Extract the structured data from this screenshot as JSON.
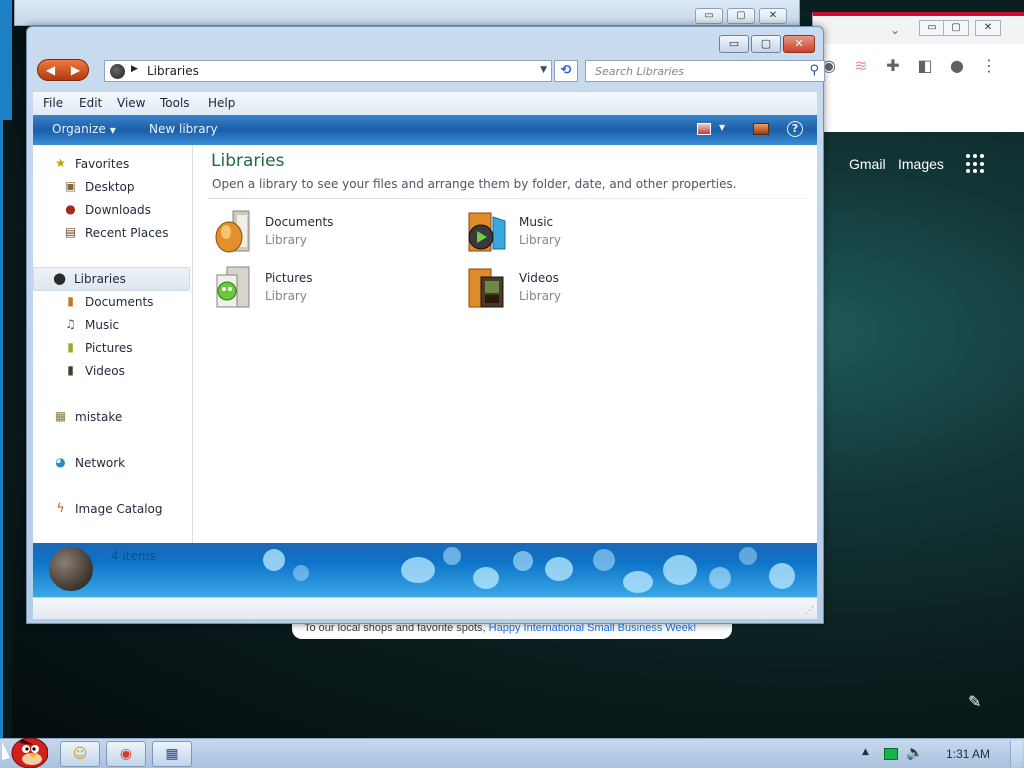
{
  "explorer": {
    "address_path": "Libraries",
    "search_placeholder": "Search Libraries",
    "window_controls": {
      "minimize": "▭",
      "maximize": "▢",
      "close": "✕"
    },
    "back_glyph": "◀",
    "forward_glyph": "▶",
    "menu": [
      "File",
      "Edit",
      "View",
      "Tools",
      "Help"
    ],
    "commands": {
      "organize": "Organize",
      "new_library": "New library",
      "help": "?"
    },
    "nav": {
      "favorites": "Favorites",
      "desktop": "Desktop",
      "downloads": "Downloads",
      "recent_places": "Recent Places",
      "libraries": "Libraries",
      "documents": "Documents",
      "music": "Music",
      "pictures": "Pictures",
      "videos": "Videos",
      "homegroup": "mistake",
      "network": "Network",
      "image_catalog": "Image Catalog"
    },
    "content": {
      "title": "Libraries",
      "subtitle": "Open a library to see your files and arrange them by folder, date, and other properties.",
      "libraries": [
        {
          "name": "Documents",
          "kind": "Library",
          "icon": "documents-folder-icon"
        },
        {
          "name": "Music",
          "kind": "Library",
          "icon": "music-folder-icon"
        },
        {
          "name": "Pictures",
          "kind": "Library",
          "icon": "pictures-folder-icon"
        },
        {
          "name": "Videos",
          "kind": "Library",
          "icon": "videos-folder-icon"
        }
      ]
    },
    "details": {
      "count": "4 items"
    }
  },
  "background": {
    "gmail": "Gmail",
    "images": "Images",
    "caption_text": "To our local shops and favorite spots, ",
    "caption_link": "Happy International Small Business Week!"
  },
  "taskbar": {
    "clock": "1:31 AM"
  },
  "colors": {
    "title_green": "#1d6a3b",
    "command_bar_blue": "#1b5ea9",
    "close_red": "#c9412a",
    "accent_orange": "#d8501e"
  }
}
